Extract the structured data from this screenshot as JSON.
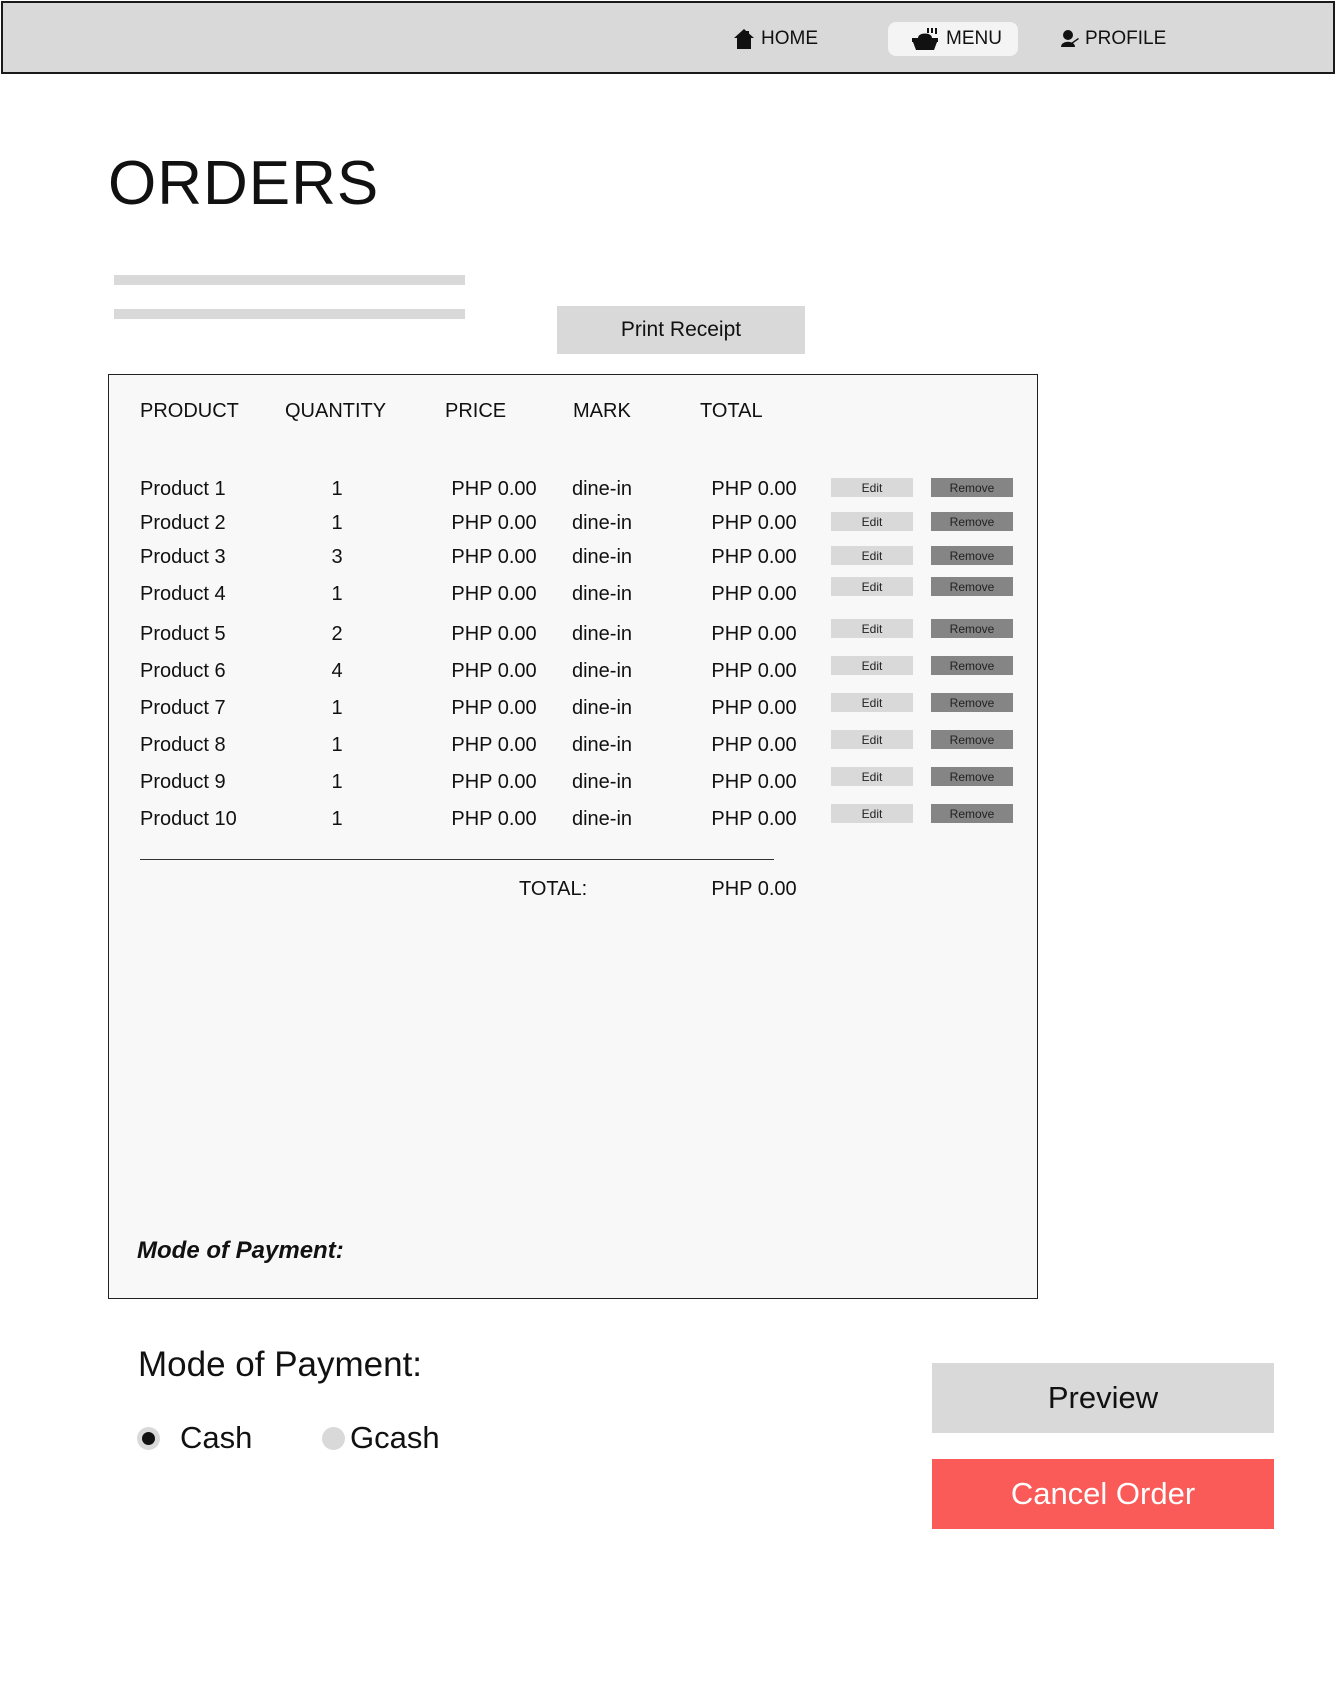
{
  "nav": {
    "items": [
      {
        "label": "HOME",
        "icon": "home-icon"
      },
      {
        "label": "MENU",
        "icon": "food-tray-icon",
        "active": true
      },
      {
        "label": "PROFILE",
        "icon": "user-icon"
      }
    ]
  },
  "page": {
    "title": "ORDERS",
    "print_label": "Print Receipt"
  },
  "receipt": {
    "headers": [
      "PRODUCT",
      "QUANTITY",
      "PRICE",
      "MARK",
      "TOTAL"
    ],
    "edit_label": "Edit",
    "remove_label": "Remove",
    "rows": [
      {
        "product": "Product 1",
        "quantity": "1",
        "price": "PHP 0.00",
        "mark": "dine-in",
        "total": "PHP 0.00"
      },
      {
        "product": "Product 2",
        "quantity": "1",
        "price": "PHP 0.00",
        "mark": "dine-in",
        "total": "PHP 0.00"
      },
      {
        "product": "Product 3",
        "quantity": "3",
        "price": "PHP 0.00",
        "mark": "dine-in",
        "total": "PHP 0.00"
      },
      {
        "product": "Product 4",
        "quantity": "1",
        "price": "PHP 0.00",
        "mark": "dine-in",
        "total": "PHP 0.00"
      },
      {
        "product": "Product 5",
        "quantity": "2",
        "price": "PHP 0.00",
        "mark": "dine-in",
        "total": "PHP 0.00"
      },
      {
        "product": "Product 6",
        "quantity": "4",
        "price": "PHP 0.00",
        "mark": "dine-in",
        "total": "PHP 0.00"
      },
      {
        "product": "Product 7",
        "quantity": "1",
        "price": "PHP 0.00",
        "mark": "dine-in",
        "total": "PHP 0.00"
      },
      {
        "product": "Product 8",
        "quantity": "1",
        "price": "PHP 0.00",
        "mark": "dine-in",
        "total": "PHP 0.00"
      },
      {
        "product": "Product 9",
        "quantity": "1",
        "price": "PHP 0.00",
        "mark": "dine-in",
        "total": "PHP 0.00"
      },
      {
        "product": "Product 10",
        "quantity": "1",
        "price": "PHP 0.00",
        "mark": "dine-in",
        "total": "PHP 0.00"
      }
    ],
    "total_label": "TOTAL:",
    "total_value": "PHP 0.00",
    "mode_of_payment_label": "Mode of Payment:"
  },
  "payment": {
    "title": "Mode of Payment:",
    "options": [
      {
        "label": "Cash",
        "selected": true
      },
      {
        "label": "Gcash",
        "selected": false
      }
    ]
  },
  "actions": {
    "preview_label": "Preview",
    "cancel_label": "Cancel Order"
  },
  "colors": {
    "nav_bg": "#d9d9d9",
    "cancel_bg": "#fa5a58",
    "remove_bg": "#858585",
    "edit_bg": "#d9d9d9"
  }
}
